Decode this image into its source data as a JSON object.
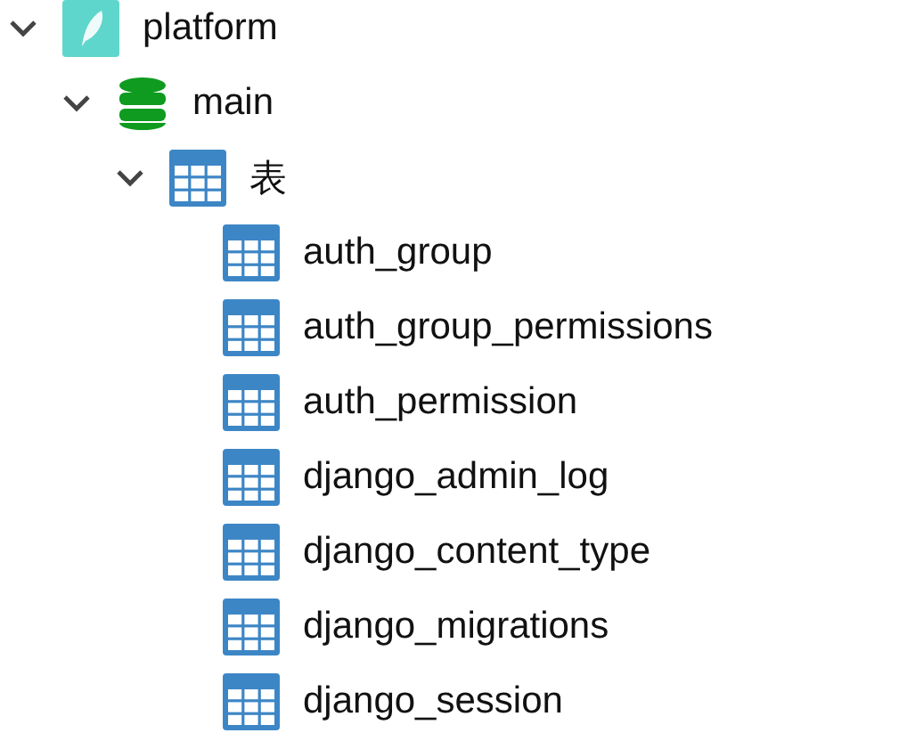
{
  "tree": [
    {
      "kind": "connection",
      "label": "platform",
      "expanded": true,
      "children": [
        {
          "kind": "database",
          "label": "main",
          "expanded": true,
          "children": [
            {
              "kind": "folder",
              "label": "表",
              "expanded": true,
              "children": [
                {
                  "kind": "table",
                  "label": "auth_group"
                },
                {
                  "kind": "table",
                  "label": "auth_group_permissions"
                },
                {
                  "kind": "table",
                  "label": "auth_permission"
                },
                {
                  "kind": "table",
                  "label": "django_admin_log"
                },
                {
                  "kind": "table",
                  "label": "django_content_type"
                },
                {
                  "kind": "table",
                  "label": "django_migrations"
                },
                {
                  "kind": "table",
                  "label": "django_session"
                }
              ]
            }
          ]
        }
      ]
    }
  ]
}
